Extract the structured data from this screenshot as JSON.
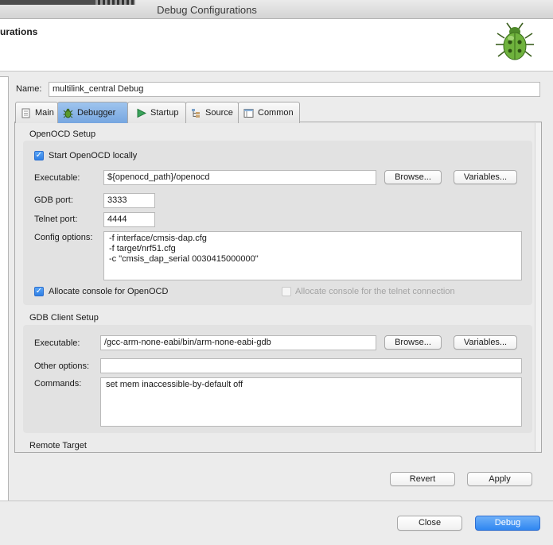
{
  "window": {
    "title": "Debug Configurations"
  },
  "banner": {
    "title": "urations"
  },
  "name": {
    "label": "Name:",
    "value": "multilink_central Debug"
  },
  "tabs": [
    {
      "label": "Main",
      "icon": "document-icon"
    },
    {
      "label": "Debugger",
      "icon": "bug-icon"
    },
    {
      "label": "Startup",
      "icon": "play-icon"
    },
    {
      "label": "Source",
      "icon": "source-icon"
    },
    {
      "label": "Common",
      "icon": "common-icon"
    }
  ],
  "openocd": {
    "section": "OpenOCD Setup",
    "start_locally": "Start OpenOCD locally",
    "executable_label": "Executable:",
    "executable_value": "${openocd_path}/openocd",
    "browse": "Browse...",
    "variables": "Variables...",
    "gdb_port_label": "GDB port:",
    "gdb_port_value": "3333",
    "telnet_port_label": "Telnet port:",
    "telnet_port_value": "4444",
    "config_label": "Config options:",
    "config_lines": [
      "-f interface/cmsis-dap.cfg",
      "-f target/nrf51.cfg",
      "-c \"cmsis_dap_serial 0030415000000\""
    ],
    "allocate_console": "Allocate console for OpenOCD",
    "allocate_telnet": "Allocate console for the telnet connection"
  },
  "gdb": {
    "section": "GDB Client Setup",
    "executable_label": "Executable:",
    "executable_value": "/gcc-arm-none-eabi/bin/arm-none-eabi-gdb",
    "browse": "Browse...",
    "variables": "Variables...",
    "other_label": "Other options:",
    "other_value": "",
    "commands_label": "Commands:",
    "commands_value": "set mem inaccessible-by-default off"
  },
  "remote": {
    "section": "Remote Target"
  },
  "actions": {
    "revert": "Revert",
    "apply": "Apply",
    "close": "Close",
    "debug": "Debug"
  }
}
